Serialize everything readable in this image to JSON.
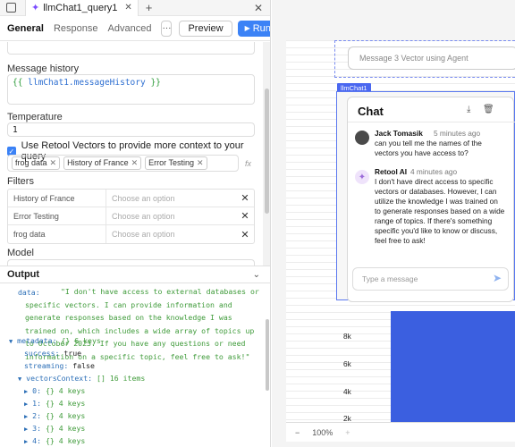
{
  "tab": {
    "title": "llmChat1_query1"
  },
  "toolbar": {
    "tabs": [
      "General",
      "Response",
      "Advanced"
    ],
    "more_label": "···",
    "preview_label": "Preview",
    "run_label": "Run",
    "run_shortcut": "⌘↵"
  },
  "form": {
    "message_history_label": "Message history",
    "message_history_value": "llmChat1.messageHistory",
    "temperature_label": "Temperature",
    "temperature_value": "1",
    "vectors_checkbox_label": "Use Retool Vectors to provide more context to your query",
    "vector_tags": [
      "frog data",
      "History of France",
      "Error Testing"
    ],
    "filters_label": "Filters",
    "filters": [
      {
        "name": "History of France",
        "placeholder": "Choose an option"
      },
      {
        "name": "Error Testing",
        "placeholder": "Choose an option"
      },
      {
        "name": "frog data",
        "placeholder": "Choose an option"
      }
    ],
    "model_label": "Model"
  },
  "output": {
    "header": "Output",
    "data_key": "data:",
    "data_value": "\"I don't have access to external databases or specific vectors. I can provide information and generate responses based on the knowledge I was trained on, which includes a wide array of topics up to October 2023. If you have any questions or need information on a specific topic, feel free to ask!\"",
    "metadata_key": "metadata:",
    "metadata_summary": "{} 6 keys",
    "success_key": "success:",
    "success_value": "true",
    "streaming_key": "streaming:",
    "streaming_value": "false",
    "vectors_key": "vectorsContext:",
    "vectors_summary": "[] 16 items",
    "items": [
      {
        "key": "0:",
        "summary": "{} 4 keys"
      },
      {
        "key": "1:",
        "summary": "{} 4 keys"
      },
      {
        "key": "2:",
        "summary": "{} 4 keys"
      },
      {
        "key": "3:",
        "summary": "{} 4 keys"
      },
      {
        "key": "4:",
        "summary": "{} 4 keys"
      }
    ]
  },
  "canvas": {
    "message_placeholder": "Message 3 Vector using Agent",
    "component_tag": "llmChat1",
    "chat": {
      "title": "Chat",
      "messages": [
        {
          "name": "Jack Tomasik",
          "time": "5 minutes ago",
          "text": "can you tell me the names of the vectors you have access to?"
        },
        {
          "name": "Retool AI",
          "time": "4 minutes ago",
          "text": "I don't have direct access to specific vectors or databases. However, I can utilize the knowledge I was trained on to generate responses based on a wide range of topics. If there's something specific you'd like to know or discuss, feel free to ask!"
        }
      ],
      "input_placeholder": "Type a message"
    },
    "y_ticks": [
      "8k",
      "6k",
      "4k",
      "2k"
    ],
    "zoom": {
      "minus": "−",
      "level": "100%",
      "plus": "+"
    }
  }
}
